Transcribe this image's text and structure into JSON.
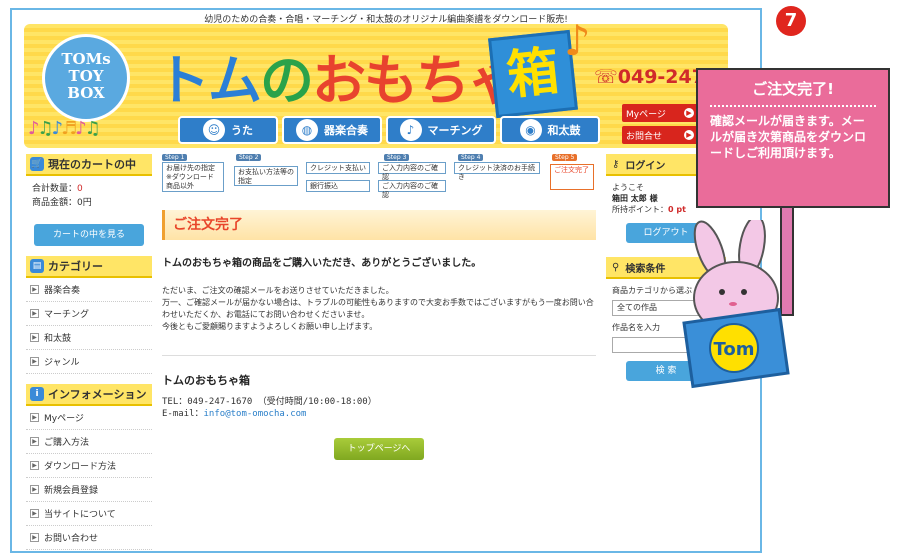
{
  "header": {
    "tagline": "幼児のための合奏・合唱・マーチング・和太鼓のオリジナル編曲楽譜をダウンロード販売!",
    "logo_lines": [
      "TOMs",
      "TOY",
      "BOX"
    ],
    "title_part1": "トム",
    "title_part2": "の",
    "title_part3": "おもちゃ",
    "title_box": "箱",
    "phone": "049-247-1670",
    "nav": [
      {
        "label": "うた",
        "icon": "smile-icon"
      },
      {
        "label": "器楽合奏",
        "icon": "drum-icon"
      },
      {
        "label": "マーチング",
        "icon": "trumpet-icon"
      },
      {
        "label": "和太鼓",
        "icon": "taiko-icon"
      }
    ],
    "mypage_label": "Myページ",
    "contact_label": "お問合せ"
  },
  "left": {
    "cart_title": "現在のカートの中",
    "cart_qty_label": "合計数量：",
    "cart_qty": "0",
    "cart_amount_label": "商品金額：",
    "cart_amount": "0円",
    "cart_button": "カートの中を見る",
    "category_title": "カテゴリー",
    "categories": [
      "器楽合奏",
      "マーチング",
      "和太鼓",
      "ジャンル"
    ],
    "info_title": "インフォメーション",
    "info_items": [
      "Myページ",
      "ご購入方法",
      "ダウンロード方法",
      "新規会員登録",
      "当サイトについて",
      "お問い合わせ"
    ]
  },
  "steps": {
    "labels": [
      "Step 1",
      "Step 2",
      "Step 3",
      "Step 4",
      "Step 5"
    ],
    "s1": "お届け先の指定 ※ダウンロード商品以外",
    "s2": "お支払い方法等の指定",
    "s2a": "クレジット支払い",
    "s2b": "銀行振込",
    "s3a": "ご入力内容のご確認",
    "s3b": "ご入力内容のご確認",
    "s4": "クレジット決済のお手続き",
    "s5": "ご注文完了"
  },
  "main": {
    "heading": "ご注文完了",
    "thanks": "トムのおもちゃ箱の商品をご購入いただき、ありがとうございました。",
    "body1": "ただいま、ご注文の確認メールをお送りさせていただきました。",
    "body2": "万一、ご確認メールが届かない場合は、トラブルの可能性もありますので大変お手数ではございますがもう一度お問い合わせいただくか、お電話にてお問い合わせくださいませ。",
    "body3": "今後ともご愛顧賜りますようよろしくお願い申し上げます。",
    "shop_name": "トムのおもちゃ箱",
    "tel": "TEL：049-247-1670 （受付時間/10:00-18:00）",
    "email_label": "E-mail：",
    "email": "info@tom-omocha.com",
    "top_button": "トップページへ"
  },
  "right": {
    "login_title": "ログイン",
    "welcome": "ようこそ",
    "user": "箱田 太郎 様",
    "points_label": "所持ポイント：",
    "points": "0 pt",
    "logout_button": "ログアウト",
    "search_title": "検索条件",
    "category_label": "商品カテゴリから選ぶ",
    "category_value": "全ての作品",
    "name_label": "作品名を入力",
    "search_button": "検 索"
  },
  "callout": {
    "badge": "7",
    "title": "ご注文完了!",
    "body": "確認メールが届きます。メールが届き次第商品をダウンロードしご利用頂けます。",
    "mascot_text": "Tom"
  }
}
